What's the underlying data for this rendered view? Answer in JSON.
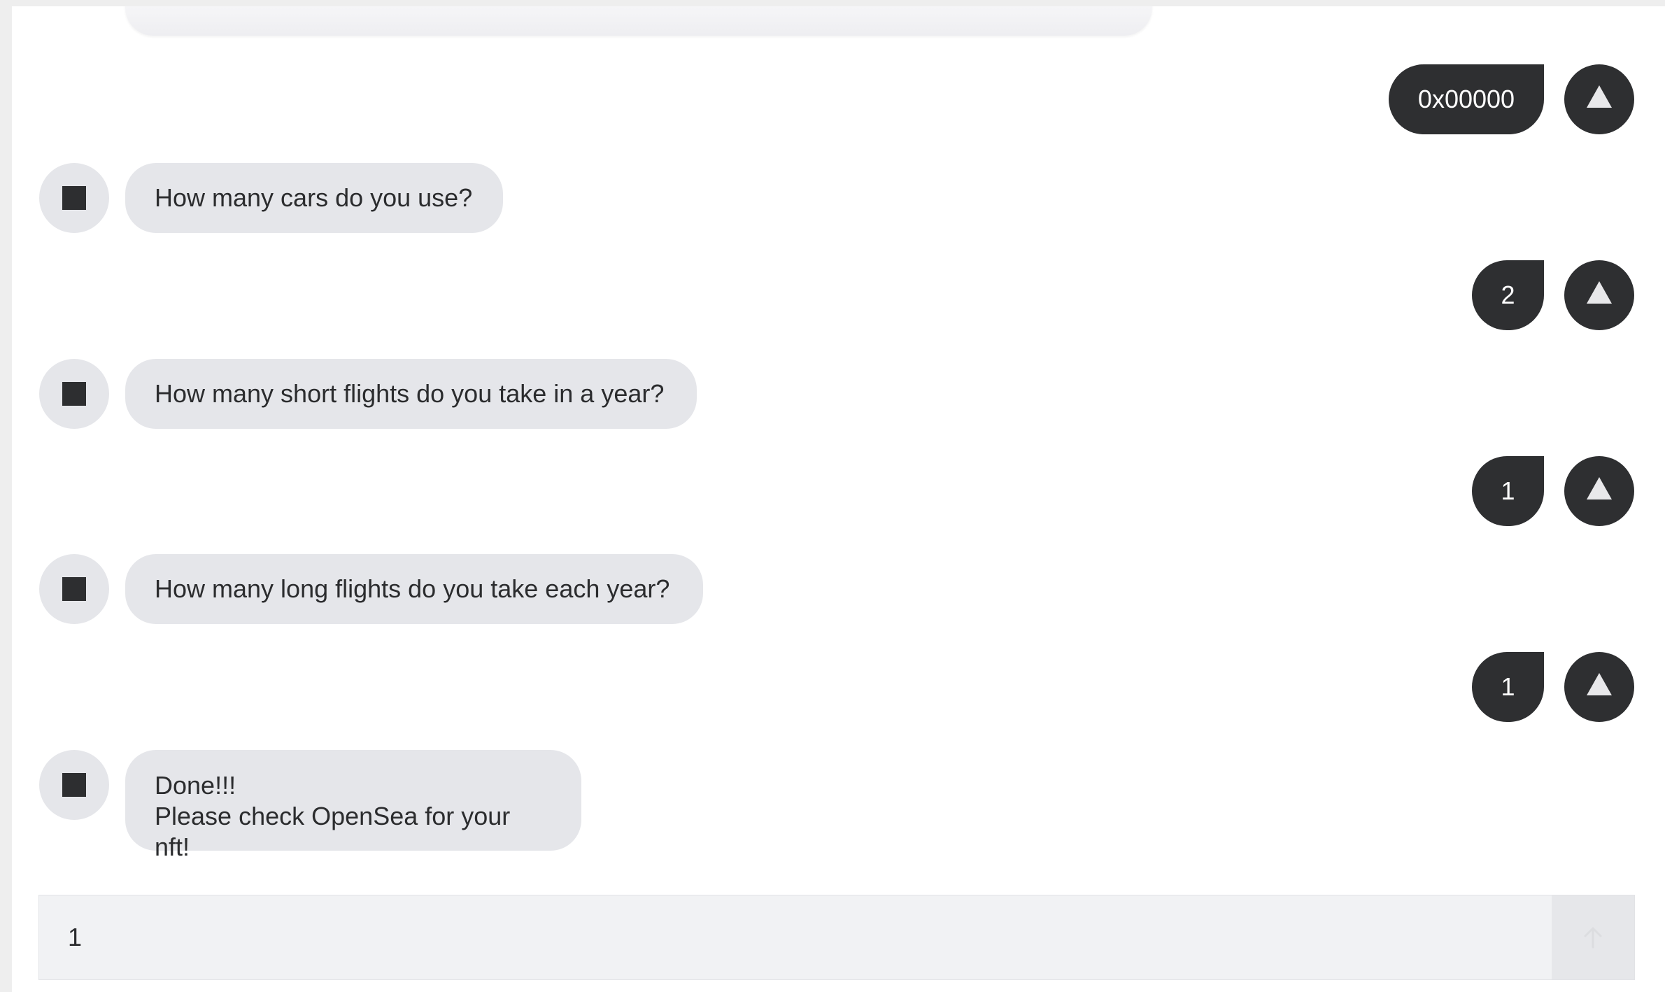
{
  "colors": {
    "page_background": "#eeeeee",
    "chat_background": "#ffffff",
    "bot_bubble": "#e5e6ea",
    "user_bubble": "#2e2f31",
    "text_dark": "#2b2c2e",
    "text_light": "#ffffff"
  },
  "messages": [
    {
      "from": "user",
      "text": "0x00000",
      "avatar_icon": "triangle-icon"
    },
    {
      "from": "bot",
      "text": "How many cars do you use?",
      "avatar_icon": "square-icon"
    },
    {
      "from": "user",
      "text": "2",
      "avatar_icon": "triangle-icon"
    },
    {
      "from": "bot",
      "text": "How many short flights do you take in a year?",
      "avatar_icon": "square-icon"
    },
    {
      "from": "user",
      "text": "1",
      "avatar_icon": "triangle-icon"
    },
    {
      "from": "bot",
      "text": "How many long flights do you take each year?",
      "avatar_icon": "square-icon"
    },
    {
      "from": "user",
      "text": "1",
      "avatar_icon": "triangle-icon"
    },
    {
      "from": "bot",
      "text": "Done!!!\nPlease check OpenSea for your nft!",
      "avatar_icon": "square-icon"
    }
  ],
  "composer": {
    "value": "1",
    "send_icon": "arrow-up-icon"
  }
}
